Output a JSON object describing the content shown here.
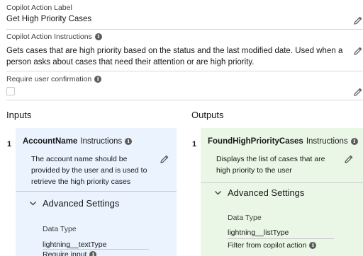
{
  "copilot_action_label": {
    "label": "Copilot Action Label",
    "value": "Get High Priority Cases"
  },
  "copilot_action_instructions": {
    "label": "Copilot Action Instructions",
    "value_line1": "Gets cases that are high priority based on the status and the last modified date. Used when a",
    "value_line2": "person asks about cases that need their attention or are high priority."
  },
  "require_confirmation": {
    "label": "Require user confirmation",
    "checked": false
  },
  "inputs": {
    "heading": "Inputs",
    "items": [
      {
        "number": "1",
        "name": "AccountName",
        "instructions_label": "Instructions",
        "description_lines": [
          "The account name should be",
          "provided by the user and is used to",
          "retrieve the high priority cases"
        ],
        "advanced_settings_label": "Advanced Settings",
        "data_type_label": "Data Type",
        "data_type_value": "lightning__textType",
        "extra_label": "Require input"
      }
    ]
  },
  "outputs": {
    "heading": "Outputs",
    "items": [
      {
        "number": "1",
        "name": "FoundHighPriorityCases",
        "instructions_label": "Instructions",
        "description_lines": [
          "Displays the list of cases that are",
          "high priority to the user"
        ],
        "advanced_settings_label": "Advanced Settings",
        "data_type_label": "Data Type",
        "data_type_value": "lightning__listType",
        "extra_label": "Filter from copilot action"
      }
    ]
  },
  "colors": {
    "input_panel_bg": "#eaf3fe",
    "output_panel_bg": "#ebf7e6",
    "divider": "#d8d8d8",
    "icon": "#5c5c5c"
  }
}
